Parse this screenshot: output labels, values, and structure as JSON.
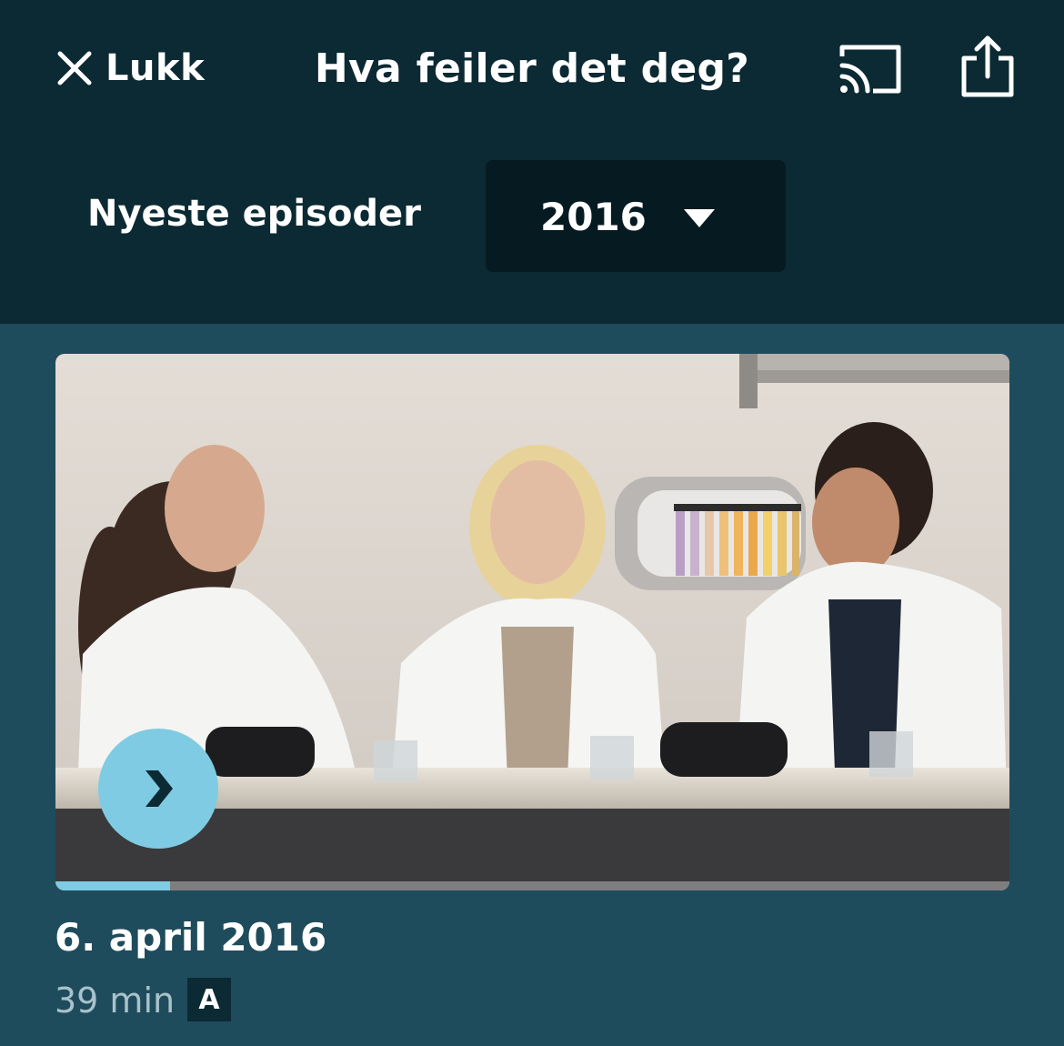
{
  "header": {
    "close_label": "Lukk",
    "title": "Hva feiler det deg?",
    "close_icon": "close-icon",
    "cast_icon": "cast-icon",
    "share_icon": "share-icon"
  },
  "season": {
    "label": "Nyeste episoder",
    "selected": "2016",
    "caret_icon": "chevron-down-icon"
  },
  "episode": {
    "date": "6. april 2016",
    "duration": "39 min",
    "rating": "A",
    "progress": 0.12,
    "play_icon": "play-icon"
  },
  "colors": {
    "header_bg": "#0b2a33",
    "page_bg": "#1f4c5c",
    "select_bg": "#061b21",
    "accent": "#7fcbe3"
  }
}
